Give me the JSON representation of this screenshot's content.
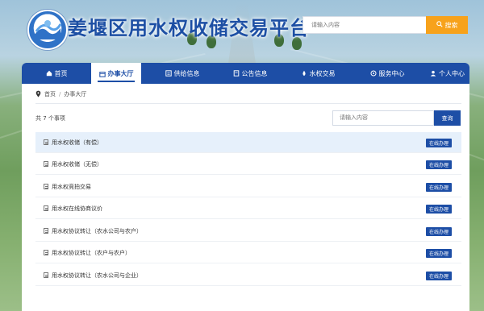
{
  "header": {
    "site_title": "姜堰区用水权收储交易平台",
    "search_placeholder": "请输入内容",
    "search_button": "搜索"
  },
  "nav": {
    "items": [
      {
        "label": "首页",
        "icon": "home-icon"
      },
      {
        "label": "办事大厅",
        "icon": "hall-icon",
        "active": true
      },
      {
        "label": "供给信息",
        "icon": "supply-icon"
      },
      {
        "label": "公告信息",
        "icon": "notice-icon"
      },
      {
        "label": "水权交易",
        "icon": "water-drop-icon"
      },
      {
        "label": "服务中心",
        "icon": "service-icon"
      },
      {
        "label": "个人中心",
        "icon": "user-icon"
      }
    ]
  },
  "breadcrumb": {
    "home": "首页",
    "separator": "/",
    "current": "办事大厅"
  },
  "list": {
    "count_text": "共 7 个事项",
    "search_placeholder": "请输入内容",
    "search_button": "查询",
    "row_button": "在线办理",
    "items": [
      {
        "label": "用水权收储（有偿）",
        "highlighted": true
      },
      {
        "label": "用水权收储（无偿）"
      },
      {
        "label": "用水权竞拍交易"
      },
      {
        "label": "用水权在线协商议价"
      },
      {
        "label": "用水权协议转让（农水公司与农户）"
      },
      {
        "label": "用水权协议转让（农户与农户）"
      },
      {
        "label": "用水权协议转让（农水公司与企业）"
      }
    ]
  },
  "colors": {
    "brand_blue": "#1d4ea6",
    "accent_orange": "#f7a21b",
    "highlight_row": "#e6f0fb"
  }
}
